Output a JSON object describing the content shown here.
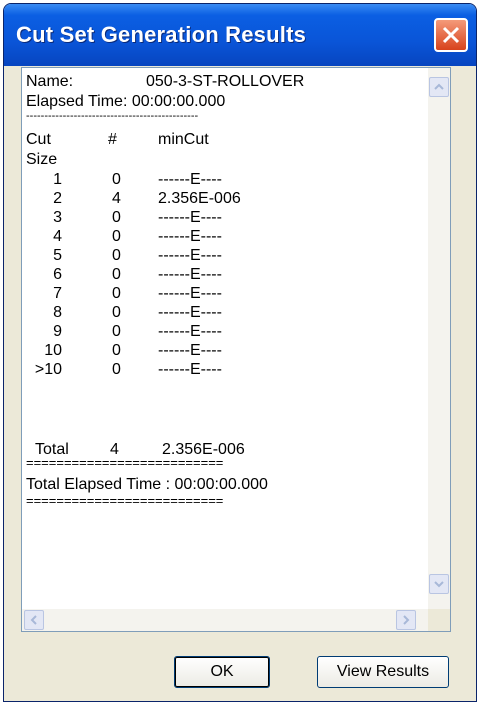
{
  "window": {
    "title": "Cut Set Generation Results"
  },
  "results": {
    "name_label": "Name:",
    "name_value": "050-3-ST-ROLLOVER",
    "elapsed_time": "Elapsed Time: 00:00:00.000",
    "separator_dashes": "-----------------------------------------------",
    "header_cut": "Cut",
    "header_count": "#",
    "header_mincut": "minCut",
    "header_size": "Size",
    "rows": [
      {
        "size": "1",
        "count": "0",
        "mincut": "------E----"
      },
      {
        "size": "2",
        "count": "4",
        "mincut": "2.356E-006"
      },
      {
        "size": "3",
        "count": "0",
        "mincut": "------E----"
      },
      {
        "size": "4",
        "count": "0",
        "mincut": "------E----"
      },
      {
        "size": "5",
        "count": "0",
        "mincut": "------E----"
      },
      {
        "size": "6",
        "count": "0",
        "mincut": "------E----"
      },
      {
        "size": "7",
        "count": "0",
        "mincut": "------E----"
      },
      {
        "size": "8",
        "count": "0",
        "mincut": "------E----"
      },
      {
        "size": "9",
        "count": "0",
        "mincut": "------E----"
      },
      {
        "size": "10",
        "count": "0",
        "mincut": "------E----"
      },
      {
        "size": ">10",
        "count": "0",
        "mincut": "------E----"
      }
    ],
    "total_label": "Total",
    "total_count": "4",
    "total_mincut": "2.356E-006",
    "separator_equals": "==========================",
    "total_elapsed": "Total Elapsed Time : 00:00:00.000"
  },
  "buttons": {
    "ok_label": "OK",
    "view_results_label": "View Results"
  },
  "colors": {
    "titlebar": "#0a55d8",
    "close": "#d8431c",
    "dialog_bg": "#ece9d8"
  }
}
